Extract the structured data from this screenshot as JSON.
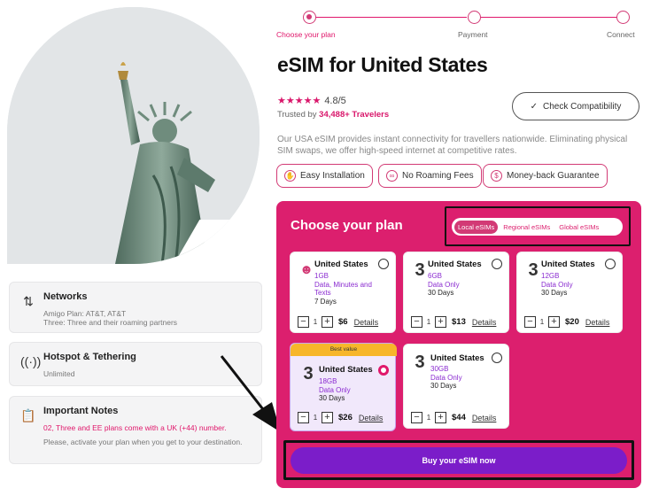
{
  "steps": {
    "plan": "Choose your plan",
    "payment": "Payment",
    "connect": "Connect"
  },
  "title": "eSIM for United States",
  "rating": {
    "value": "4.8/5",
    "trusted_prefix": "Trusted by ",
    "trusted_count": "34,488+ Travelers",
    "stars": "★★★★★"
  },
  "compat_button": "Check Compatibility",
  "description": "Our USA eSIM provides instant connectivity for travellers nationwide. Eliminating physical SIM swaps, we offer high-speed internet at competitive rates.",
  "chips": [
    "Easy Installation",
    "No Roaming Fees",
    "Money-back Guarantee"
  ],
  "panel": {
    "title": "Choose your plan",
    "tabs": [
      "Local eSIMs",
      "Regional eSIMs",
      "Global eSIMs"
    ],
    "buy_label": "Buy your eSIM now"
  },
  "plans": [
    {
      "country": "United States",
      "data": "1GB",
      "type": "Data, Minutes and Texts",
      "type2": "",
      "days": "7 Days",
      "qty": "1",
      "price": "$6",
      "details": "Details",
      "logo": "☻"
    },
    {
      "country": "United States",
      "data": "6GB",
      "type": "Data Only",
      "type2": "",
      "days": "30 Days",
      "qty": "1",
      "price": "$13",
      "details": "Details",
      "logo": "3"
    },
    {
      "country": "United States",
      "data": "12GB",
      "type": "Data Only",
      "type2": "",
      "days": "30 Days",
      "qty": "1",
      "price": "$20",
      "details": "Details",
      "logo": "3"
    },
    {
      "country": "United States",
      "data": "18GB",
      "type": "Data Only",
      "type2": "",
      "days": "30 Days",
      "qty": "1",
      "price": "$26",
      "details": "Details",
      "logo": "3",
      "badge": "Best value"
    },
    {
      "country": "United States",
      "data": "30GB",
      "type": "Data Only",
      "type2": "",
      "days": "30 Days",
      "qty": "1",
      "price": "$44",
      "details": "Details",
      "logo": "3"
    }
  ],
  "info": {
    "networks": {
      "title": "Networks",
      "line1": "Amigo Plan: AT&T, AT&T",
      "line2": "Three: Three and their roaming partners"
    },
    "hotspot": {
      "title": "Hotspot & Tethering",
      "line1": "Unlimited"
    },
    "notes": {
      "title": "Important Notes",
      "line1": "02, Three and EE plans come with a UK (+44) number.",
      "line2": "Please, activate your plan when you get to your destination."
    }
  },
  "colors": {
    "brand": "#dc1f6e",
    "buy": "#7b1dc9",
    "best": "#f7b62a"
  }
}
